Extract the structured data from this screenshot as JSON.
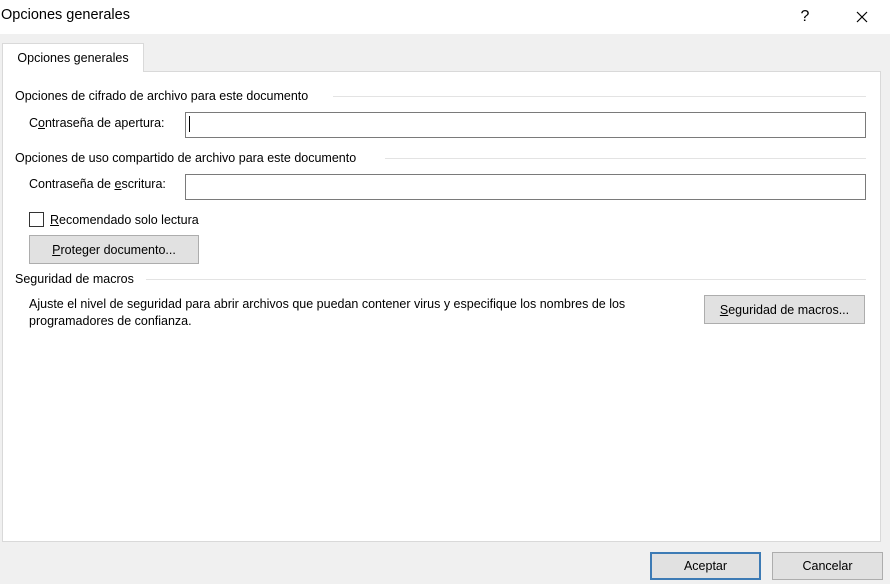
{
  "window": {
    "title": "Opciones generales",
    "help_label": "?",
    "close_icon": "close-icon"
  },
  "tabs": [
    {
      "label": "Opciones generales",
      "active": true
    }
  ],
  "encryption": {
    "header": "Opciones de cifrado de archivo para este documento",
    "open_password_label_pre": "C",
    "open_password_label_accel": "o",
    "open_password_label_post": "ntraseña de apertura:",
    "open_password_value": ""
  },
  "sharing": {
    "header": "Opciones de uso compartido de archivo para este documento",
    "write_password_label_pre": "Contraseña de ",
    "write_password_label_accel": "e",
    "write_password_label_post": "scritura:",
    "write_password_value": "",
    "readonly_accel": "R",
    "readonly_rest": "ecomendado solo lectura",
    "readonly_checked": false,
    "protect_accel": "P",
    "protect_rest": "roteger documento..."
  },
  "macros": {
    "header": "Seguridad de macros",
    "description": "Ajuste el nivel de seguridad para abrir archivos que puedan contener virus y especifique los nombres de los programadores de confianza.",
    "button_accel": "S",
    "button_rest": "eguridad de macros..."
  },
  "footer": {
    "accept_label": "Aceptar",
    "cancel_label": "Cancelar"
  },
  "colors": {
    "dialog_bg": "#f0f0f0",
    "panel_bg": "#ffffff",
    "default_button_border": "#3d7bb5",
    "button_bg": "#e1e1e1"
  }
}
